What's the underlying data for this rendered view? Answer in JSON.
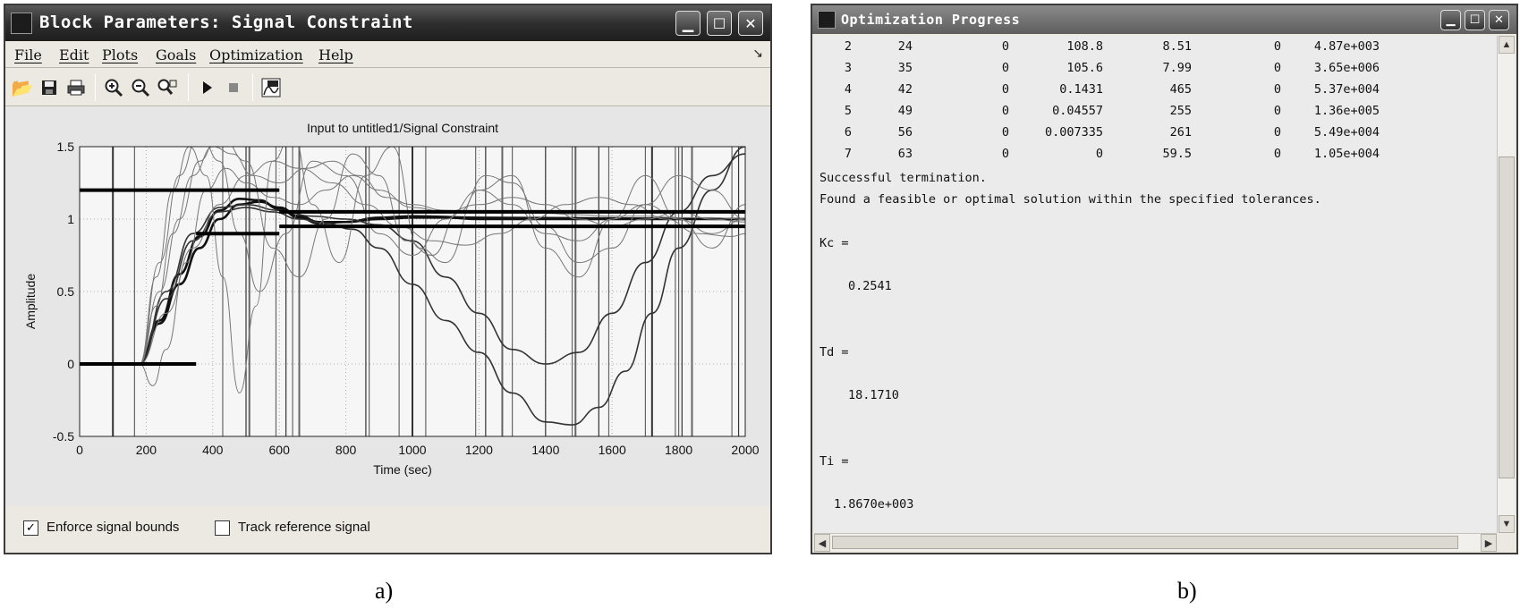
{
  "window_a": {
    "title": "Block Parameters: Signal Constraint",
    "menu": [
      "File",
      "Edit",
      "Plots",
      "Goals",
      "Optimization",
      "Help"
    ],
    "menu_arrow_icon": "arrow-icon",
    "toolbar_icons": [
      "open-icon",
      "save-icon",
      "print-icon",
      "zoom-in-icon",
      "zoom-out-icon",
      "zoom-fit-icon",
      "play-icon",
      "stop-icon",
      "response-icon"
    ],
    "checkbox_enforce": {
      "label": "Enforce signal bounds",
      "checked": true
    },
    "checkbox_track": {
      "label": "Track reference signal",
      "checked": false
    }
  },
  "chart_data": {
    "type": "line",
    "title": "Input to untitled1/Signal Constraint",
    "xlabel": "Time (sec)",
    "ylabel": "Amplitude",
    "xlim": [
      0,
      2000
    ],
    "ylim": [
      -0.5,
      1.5
    ],
    "xticks": [
      "0",
      "200",
      "400",
      "600",
      "800",
      "1000",
      "1200",
      "1400",
      "1600",
      "1800",
      "2000"
    ],
    "yticks": [
      "-0.5",
      "0",
      "0.5",
      "1",
      "1.5"
    ],
    "grid": true,
    "bounds": {
      "upper": [
        [
          0,
          1.2
        ],
        [
          600,
          1.2
        ],
        [
          600,
          1.05
        ],
        [
          2000,
          1.05
        ]
      ],
      "lower": [
        [
          0,
          0
        ],
        [
          350,
          0
        ],
        [
          350,
          0.9
        ],
        [
          600,
          0.9
        ],
        [
          600,
          0.95
        ],
        [
          2000,
          0.95
        ]
      ]
    },
    "series": [
      {
        "style": "thick",
        "x": [
          180,
          240,
          300,
          360,
          420,
          480,
          540,
          600,
          660,
          720,
          800,
          900,
          1000,
          1100,
          1200,
          1400,
          1600,
          2000
        ],
        "y": [
          0,
          0.28,
          0.55,
          0.8,
          1.0,
          1.1,
          1.12,
          1.08,
          1.02,
          0.98,
          0.98,
          1.0,
          1.01,
          1.01,
          1.0,
          1.0,
          1.0,
          1.0
        ]
      },
      {
        "style": "thick",
        "x": [
          180,
          240,
          300,
          360,
          420,
          480,
          540,
          600,
          660,
          720,
          800,
          900,
          1000,
          1200,
          2000
        ],
        "y": [
          0,
          0.3,
          0.62,
          0.88,
          1.06,
          1.14,
          1.13,
          1.07,
          1.01,
          0.97,
          0.98,
          1.01,
          1.02,
          1.01,
          1.0
        ]
      },
      {
        "style": "medium",
        "x": [
          180,
          260,
          340,
          420,
          500,
          580,
          660,
          740,
          820,
          900,
          1000,
          1100,
          1200,
          1300,
          1400,
          1480,
          1560,
          1640,
          1720,
          1800,
          1900,
          2000
        ],
        "y": [
          0,
          0.45,
          0.85,
          1.05,
          1.08,
          1.05,
          1.0,
          0.97,
          0.93,
          0.8,
          0.55,
          0.3,
          0.08,
          -0.2,
          -0.4,
          -0.42,
          -0.3,
          -0.05,
          0.35,
          0.8,
          1.2,
          1.5
        ]
      },
      {
        "style": "medium",
        "x": [
          180,
          260,
          340,
          420,
          500,
          600,
          700,
          800,
          900,
          1000,
          1100,
          1200,
          1300,
          1400,
          1500,
          1600,
          1700,
          1800,
          1900,
          2000
        ],
        "y": [
          0,
          0.5,
          0.9,
          1.08,
          1.1,
          1.06,
          1.02,
          1.0,
          0.96,
          0.85,
          0.6,
          0.35,
          0.1,
          0.0,
          0.08,
          0.35,
          0.7,
          1.05,
          1.3,
          1.45
        ]
      },
      {
        "style": "thin",
        "x": [
          180,
          230,
          280,
          330,
          380,
          430,
          480,
          530,
          580,
          640,
          700,
          780,
          860,
          940,
          1020,
          1100,
          1200,
          1300,
          1400,
          1500,
          1600,
          1700,
          1800,
          1900,
          2000
        ],
        "y": [
          0,
          0.6,
          1.2,
          1.5,
          1.3,
          0.6,
          -0.2,
          0.4,
          1.4,
          1.6,
          1.1,
          0.7,
          1.3,
          1.5,
          0.8,
          0.7,
          1.2,
          1.3,
          0.8,
          0.6,
          1.0,
          1.3,
          1.0,
          0.8,
          1.1
        ]
      },
      {
        "style": "thin",
        "x": [
          180,
          240,
          300,
          360,
          420,
          480,
          540,
          620,
          700,
          800,
          900,
          1000,
          1100,
          1200,
          1300,
          1400,
          1500,
          1600,
          1700,
          1800,
          1900,
          2000
        ],
        "y": [
          0,
          0.7,
          1.3,
          1.6,
          1.4,
          0.9,
          0.5,
          0.9,
          1.4,
          1.3,
          0.9,
          0.75,
          1.0,
          1.2,
          1.1,
          0.9,
          0.85,
          1.0,
          1.1,
          1.0,
          0.9,
          1.0
        ]
      },
      {
        "style": "thin",
        "x": [
          180,
          220,
          260,
          320,
          380,
          440,
          500,
          580,
          660,
          740,
          820,
          900,
          1000,
          1100,
          1200,
          1300,
          1400,
          1500,
          1600,
          1700,
          1800,
          1900,
          2000
        ],
        "y": [
          0,
          -0.15,
          0.1,
          0.7,
          1.2,
          1.35,
          1.25,
          1.15,
          1.1,
          1.2,
          1.3,
          1.2,
          1.08,
          1.05,
          1.1,
          1.15,
          1.1,
          1.0,
          0.95,
          1.0,
          1.05,
          1.0,
          0.98
        ]
      },
      {
        "style": "thin",
        "x": [
          180,
          230,
          280,
          340,
          400,
          460,
          520,
          600,
          680,
          760,
          840,
          920,
          1000,
          1100,
          1200,
          1300,
          1400,
          1500,
          1600,
          1700,
          1800,
          1900,
          2000
        ],
        "y": [
          0,
          0.4,
          0.9,
          1.3,
          1.5,
          1.45,
          1.3,
          1.25,
          1.35,
          1.4,
          1.3,
          1.15,
          1.1,
          1.06,
          1.05,
          1.05,
          1.04,
          1.03,
          1.02,
          1.02,
          1.01,
          1.01,
          1.0
        ]
      },
      {
        "style": "thin",
        "x": [
          180,
          240,
          300,
          360,
          420,
          500,
          580,
          660,
          740,
          820,
          900,
          980,
          1060,
          1140,
          1220,
          1300,
          1400,
          1500,
          1600,
          1700,
          1800,
          1900,
          2000
        ],
        "y": [
          0,
          0.5,
          1.0,
          1.4,
          1.6,
          1.4,
          0.8,
          0.6,
          1.0,
          1.45,
          1.3,
          0.85,
          0.75,
          1.05,
          1.3,
          1.25,
          0.95,
          0.7,
          0.8,
          1.1,
          1.3,
          1.2,
          1.0
        ]
      },
      {
        "style": "thin",
        "x": [
          180,
          260,
          340,
          420,
          500,
          580,
          660,
          760,
          860,
          960,
          1060,
          1160,
          1260,
          1360,
          1460,
          1560,
          1660,
          1760,
          1860,
          1960,
          2000
        ],
        "y": [
          0,
          0.35,
          0.8,
          1.1,
          1.3,
          1.4,
          1.35,
          1.25,
          1.1,
          0.95,
          0.85,
          0.82,
          0.9,
          1.0,
          1.1,
          1.15,
          1.1,
          1.0,
          0.9,
          0.88,
          0.9
        ]
      }
    ],
    "spikes_x": [
      100,
      165,
      430,
      500,
      510,
      590,
      620,
      640,
      660,
      860,
      870,
      960,
      1000,
      1040,
      1190,
      1220,
      1270,
      1300,
      1400,
      1480,
      1490,
      1560,
      1590,
      1700,
      1720,
      1790,
      1800,
      1810,
      1840,
      1960,
      1980
    ]
  },
  "window_b": {
    "title": "Optimization Progress",
    "rows": [
      [
        "2",
        "24",
        "0",
        "108.8",
        "8.51",
        "0",
        "4.87e+003"
      ],
      [
        "3",
        "35",
        "0",
        "105.6",
        "7.99",
        "0",
        "3.65e+006"
      ],
      [
        "4",
        "42",
        "0",
        "0.1431",
        "465",
        "0",
        "5.37e+004"
      ],
      [
        "5",
        "49",
        "0",
        "0.04557",
        "255",
        "0",
        "1.36e+005"
      ],
      [
        "6",
        "56",
        "0",
        "0.007335",
        "261",
        "0",
        "5.49e+004"
      ],
      [
        "7",
        "63",
        "0",
        "0",
        "59.5",
        "0",
        "1.05e+004"
      ]
    ],
    "msg1": "Successful termination.",
    "msg2": "Found a feasible or optimal solution within the specified tolerances.",
    "kc_label": "Kc =",
    "kc_value": "0.2541",
    "td_label": "Td =",
    "td_value": "18.1710",
    "ti_label": "Ti =",
    "ti_value": "1.8670e+003"
  },
  "captions": {
    "a": "a)",
    "b": "b)"
  }
}
